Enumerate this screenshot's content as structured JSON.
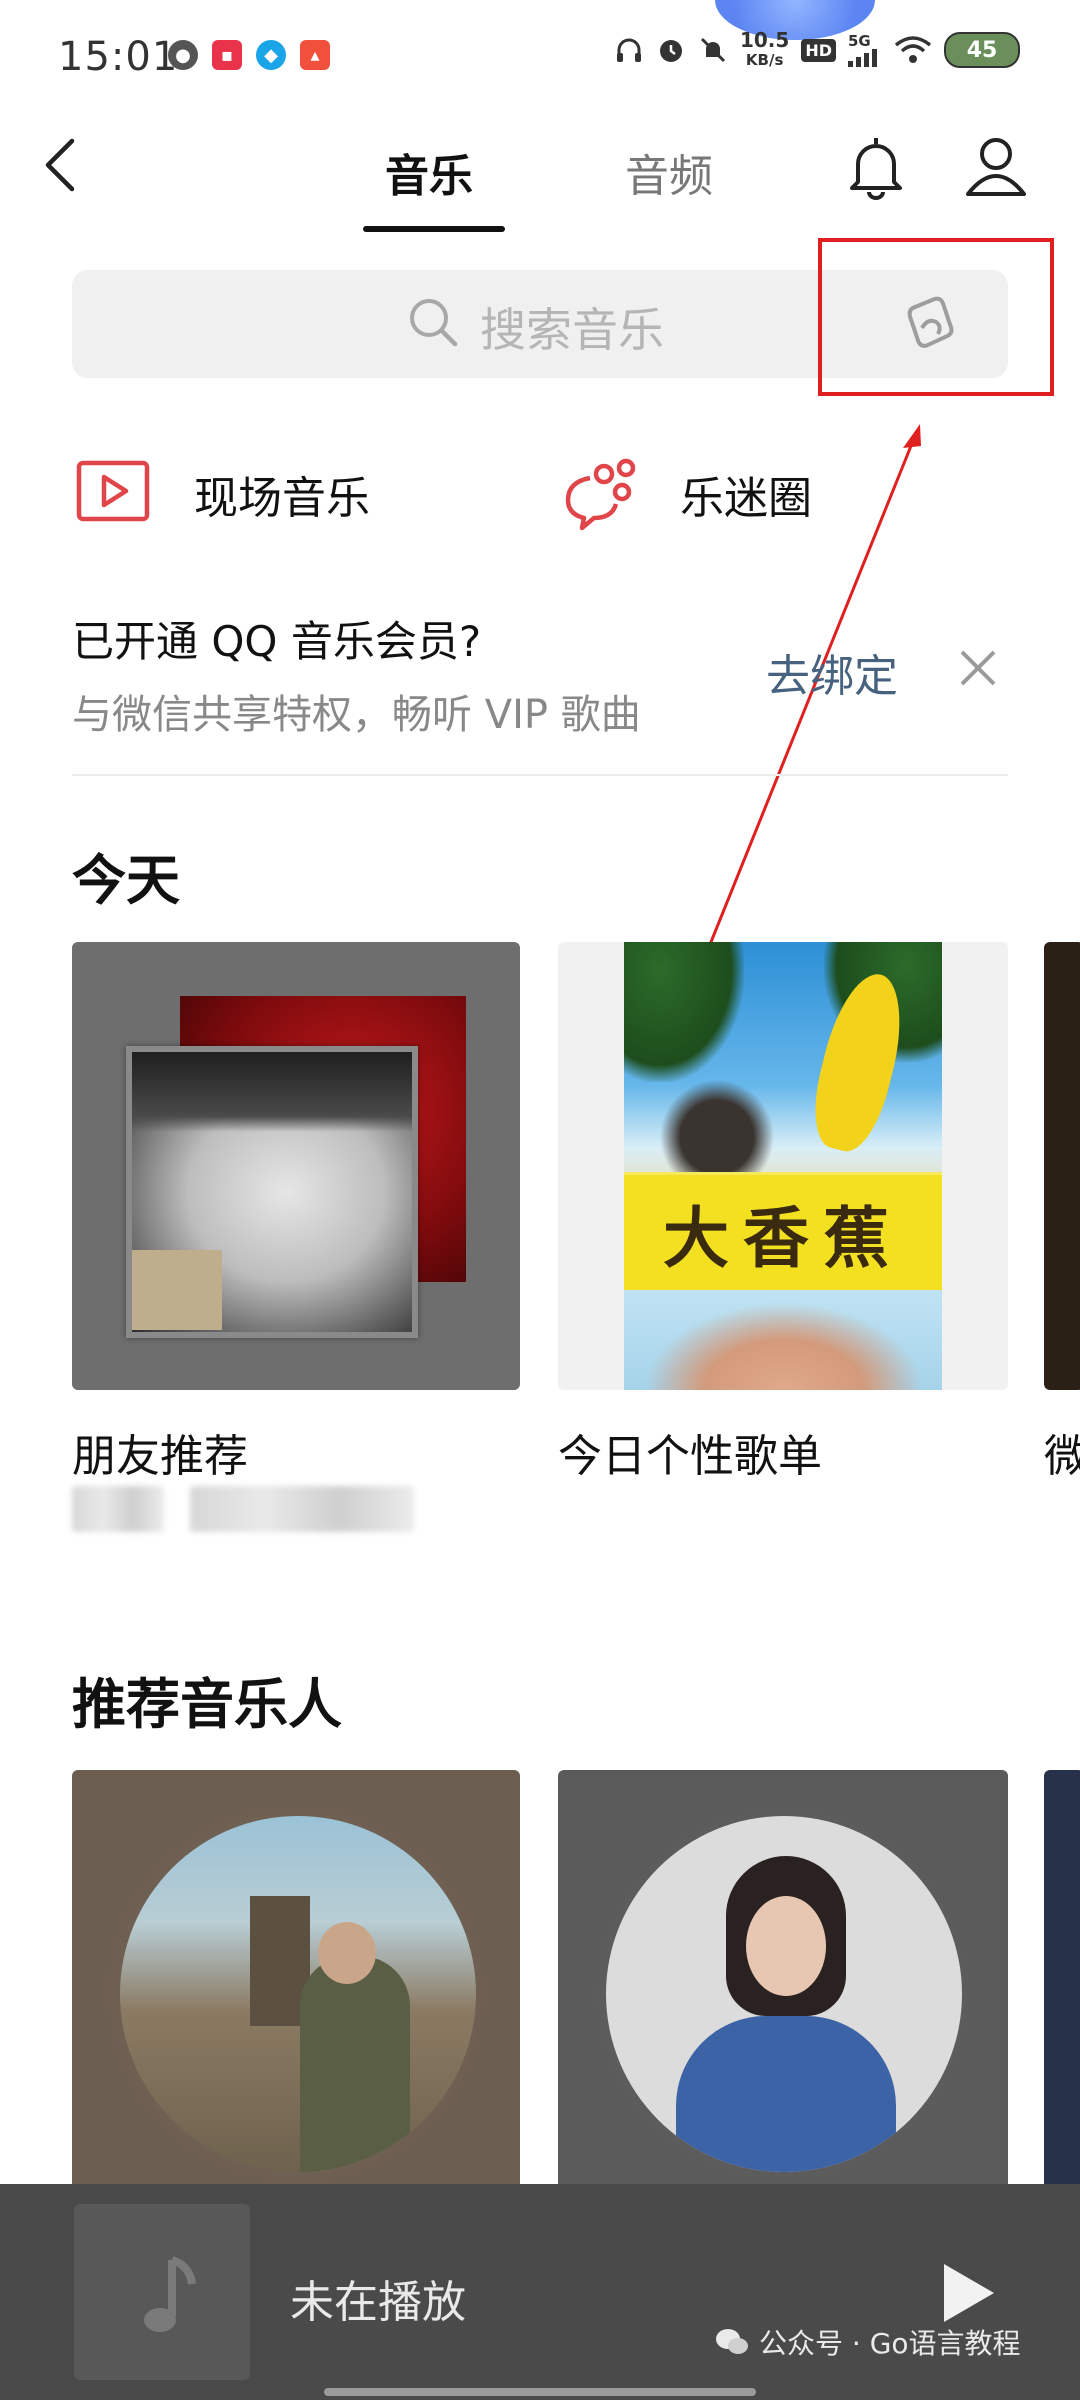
{
  "status_bar": {
    "time": "15:01",
    "net_speed_value": "10.5",
    "net_speed_unit": "KB/s",
    "hd_badge": "HD",
    "network": "5G",
    "battery": "45"
  },
  "header": {
    "tabs": [
      {
        "label": "音乐",
        "active": true
      },
      {
        "label": "音频",
        "active": false
      }
    ]
  },
  "search": {
    "placeholder": "搜索音乐"
  },
  "quick_links": [
    {
      "label": "现场音乐",
      "icon": "live-video-icon"
    },
    {
      "label": "乐迷圈",
      "icon": "fan-circle-icon"
    }
  ],
  "vip_banner": {
    "title": "已开通 QQ 音乐会员?",
    "subtitle": "与微信共享特权，畅听 VIP 歌曲",
    "action": "去绑定"
  },
  "today": {
    "title": "今天",
    "cards": [
      {
        "label": "朋友推荐"
      },
      {
        "label": "今日个性歌单",
        "cover_text": "大香蕉"
      },
      {
        "label": "微"
      }
    ]
  },
  "artists": {
    "title": "推荐音乐人"
  },
  "player": {
    "status": "未在播放"
  },
  "watermark": {
    "text": "公众号 · Go语言教程"
  },
  "colors": {
    "accent_red": "#e02020",
    "bind_link": "#46627e",
    "player_bg": "#4a4a4a"
  }
}
